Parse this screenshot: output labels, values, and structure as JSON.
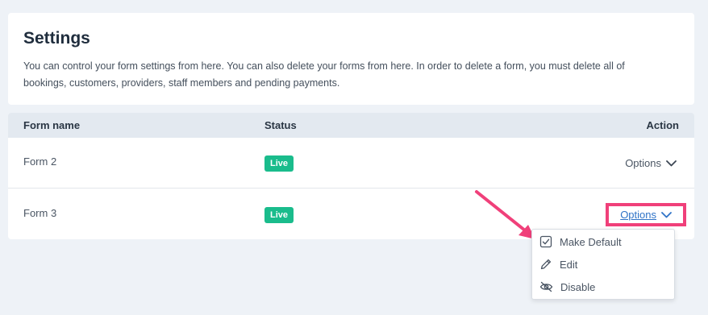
{
  "header": {
    "title": "Settings",
    "description": "You can control your form settings from here. You can also delete your forms from here. In order to delete a form, you must delete all of bookings, customers, providers, staff members and pending payments."
  },
  "table": {
    "columns": {
      "name": "Form name",
      "status": "Status",
      "action": "Action"
    },
    "rows": [
      {
        "name": "Form 2",
        "status": "Live",
        "action": "Options"
      },
      {
        "name": "Form 3",
        "status": "Live",
        "action": "Options"
      }
    ]
  },
  "dropdown": {
    "items": [
      {
        "label": "Make Default",
        "icon": "checkbox-icon"
      },
      {
        "label": "Edit",
        "icon": "pencil-icon"
      },
      {
        "label": "Disable",
        "icon": "eye-slash-icon"
      }
    ]
  },
  "colors": {
    "accent": "#2f73c7",
    "status_live": "#1abc8c",
    "highlight": "#f0407a"
  }
}
